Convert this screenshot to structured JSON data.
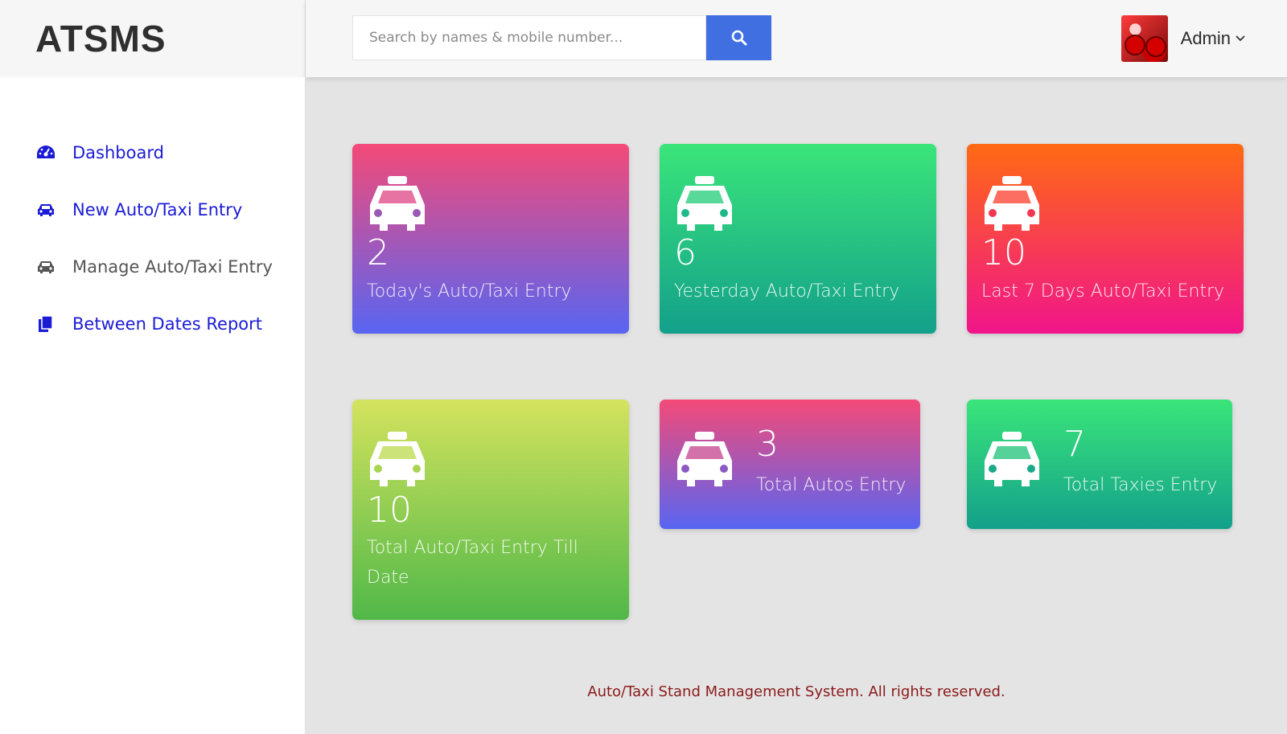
{
  "brand": {
    "title": "ATSMS"
  },
  "search": {
    "placeholder": "Search by names & mobile number..."
  },
  "user": {
    "name": "Admin"
  },
  "sidebar": {
    "items": [
      {
        "label": "Dashboard",
        "icon": "dashboard-icon"
      },
      {
        "label": "New Auto/Taxi Entry",
        "icon": "car-icon"
      },
      {
        "label": "Manage Auto/Taxi Entry",
        "icon": "car-icon"
      },
      {
        "label": "Between Dates Report",
        "icon": "files-icon"
      }
    ]
  },
  "cards": [
    {
      "value": "2",
      "label": "Today's Auto/Taxi Entry",
      "icon": "taxi-icon"
    },
    {
      "value": "6",
      "label": "Yesterday Auto/Taxi Entry",
      "icon": "taxi-icon"
    },
    {
      "value": "10",
      "label": "Last 7 Days Auto/Taxi Entry",
      "icon": "taxi-icon"
    },
    {
      "value": "10",
      "label": "Total Auto/Taxi Entry Till Date",
      "icon": "taxi-icon"
    },
    {
      "value": "3",
      "label": "Total Autos Entry",
      "icon": "taxi-icon"
    },
    {
      "value": "7",
      "label": "Total Taxies Entry",
      "icon": "taxi-icon"
    }
  ],
  "colors": {
    "search_button": "#3f6fe0",
    "nav_link": "#1b1bd6",
    "footer_text": "#8b1a1a"
  },
  "footer": {
    "text": "Auto/Taxi Stand Management System. All rights reserved."
  }
}
